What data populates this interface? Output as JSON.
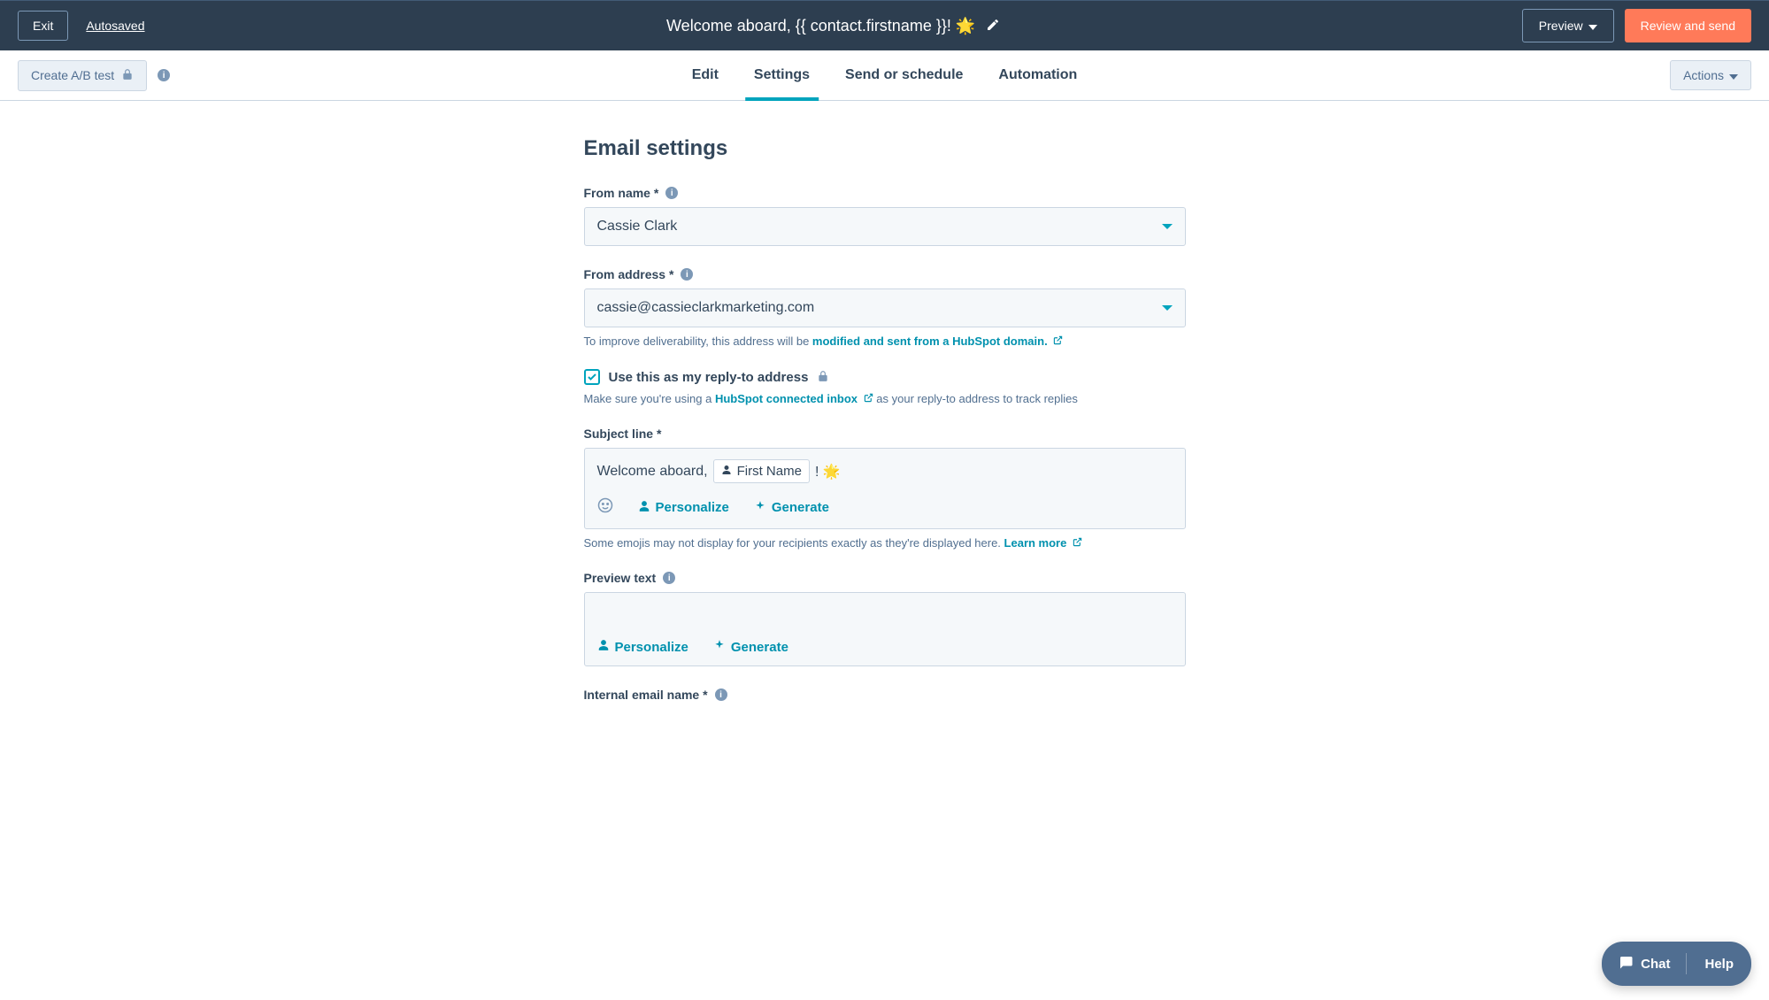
{
  "topbar": {
    "exit": "Exit",
    "autosaved": "Autosaved",
    "title": "Welcome aboard, {{ contact.firstname }}! 🌟",
    "preview": "Preview",
    "review_send": "Review and send"
  },
  "subbar": {
    "ab_test": "Create A/B test",
    "tabs": {
      "edit": "Edit",
      "settings": "Settings",
      "send": "Send or schedule",
      "automation": "Automation"
    },
    "actions": "Actions"
  },
  "page": {
    "title": "Email settings"
  },
  "from_name": {
    "label": "From name *",
    "value": "Cassie Clark"
  },
  "from_address": {
    "label": "From address *",
    "value": "cassie@cassieclarkmarketing.com",
    "helper_prefix": "To improve deliverability, this address will be ",
    "helper_link": "modified and sent from a HubSpot domain."
  },
  "reply_to": {
    "checkbox_label": "Use this as my reply-to address",
    "helper_prefix": "Make sure you're using a ",
    "helper_link": "HubSpot connected inbox",
    "helper_suffix": " as your reply-to address to track replies"
  },
  "subject": {
    "label": "Subject line *",
    "prefix_text": "Welcome aboard, ",
    "token": "First Name",
    "suffix_text": " ! 🌟",
    "personalize": "Personalize",
    "generate": "Generate",
    "helper_prefix": "Some emojis may not display for your recipients exactly as they're displayed here. ",
    "helper_link": "Learn more"
  },
  "preview_text": {
    "label": "Preview text",
    "personalize": "Personalize",
    "generate": "Generate"
  },
  "internal_name": {
    "label": "Internal email name *"
  },
  "help_widget": {
    "chat": "Chat",
    "help": "Help"
  }
}
